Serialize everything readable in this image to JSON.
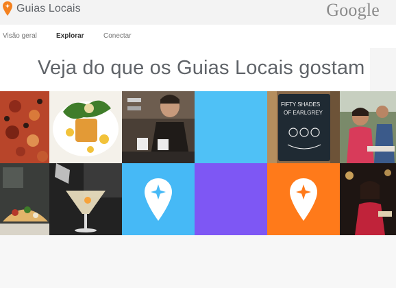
{
  "header": {
    "brand_label": "Guias Locais",
    "google_logo": "Google"
  },
  "nav": {
    "items": [
      "Visão geral",
      "Explorar",
      "Conectar"
    ],
    "active": "Explorar"
  },
  "hero": {
    "title": "Veja do que os Guias Locais gostam"
  },
  "tiles": {
    "chalkboard_line1": "FIFTY SHADES",
    "chalkboard_line2": "OF EARLGREY"
  },
  "colors": {
    "orange_pin": "#f4811f",
    "blue_tile": "#4fc1f6",
    "purple_tile": "#7e57f4",
    "orange_tile": "#ff7a1a"
  },
  "icons": [
    "local-guides-pin-icon",
    "local-guides-star-pin-icon"
  ]
}
